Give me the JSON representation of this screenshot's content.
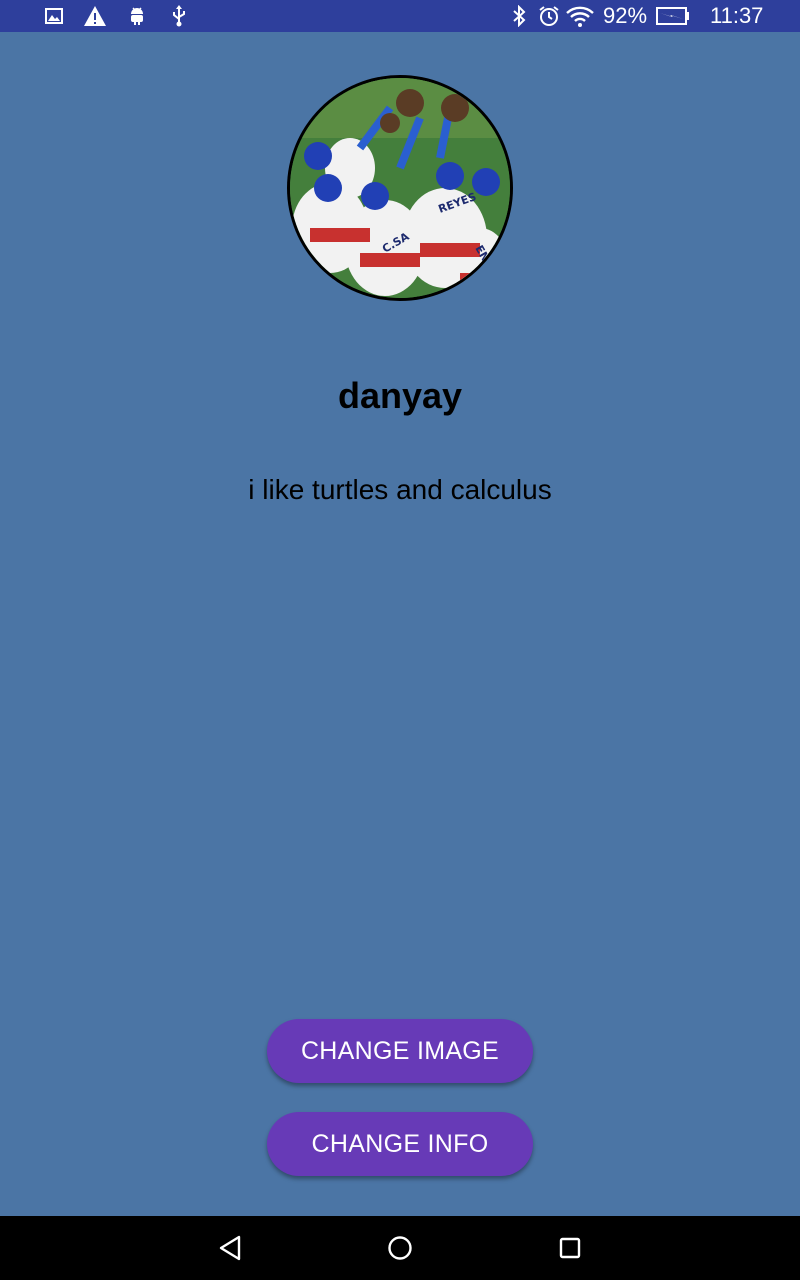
{
  "status_bar": {
    "battery_percent": "92%",
    "time": "11:37",
    "left_icons": [
      "image-icon",
      "warning-icon",
      "android-icon",
      "usb-icon"
    ],
    "right_icons": [
      "bluetooth-icon",
      "alarm-icon",
      "wifi-icon",
      "battery-charging-icon"
    ]
  },
  "profile": {
    "username": "danyay",
    "bio": "i like turtles and calculus",
    "avatar_icon": "profile-photo"
  },
  "actions": {
    "change_image_label": "CHANGE IMAGE",
    "change_info_label": "CHANGE INFO"
  },
  "nav_bar": {
    "icons": [
      "back-icon",
      "home-icon",
      "recents-icon"
    ]
  },
  "colors": {
    "status_bar": "#2e3f9c",
    "background": "#4b75a5",
    "button": "#673ab7",
    "nav_bar": "#000000"
  }
}
